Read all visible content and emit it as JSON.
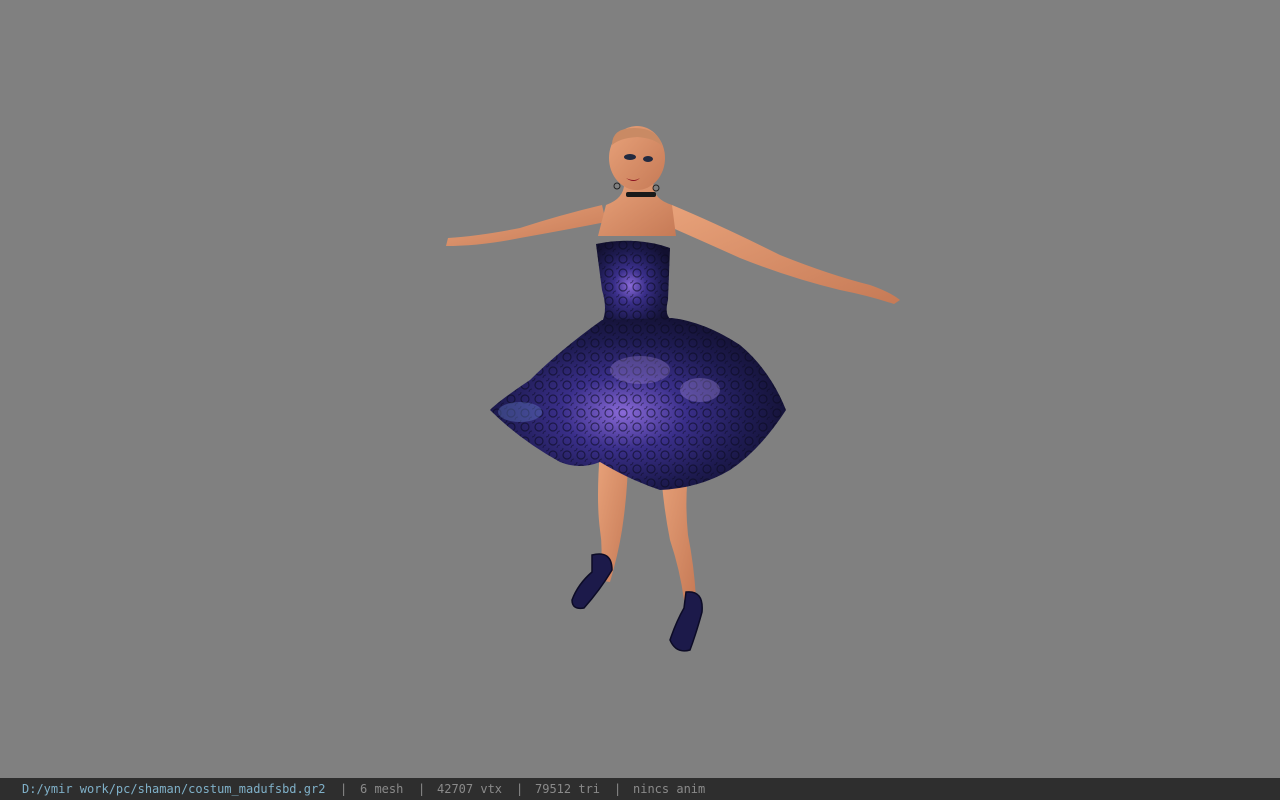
{
  "statusbar": {
    "path": "D:/ymir work/pc/shaman/costum_madufsbd.gr2",
    "separator": "|",
    "mesh": "6 mesh",
    "vtx": "42707 vtx",
    "tri": "79512 tri",
    "anim": "nincs anim"
  },
  "colors": {
    "background": "#808080",
    "statusbar_bg": "#2e2e2e",
    "path_text": "#7fb0c8",
    "stat_text": "#8a8a8a"
  }
}
